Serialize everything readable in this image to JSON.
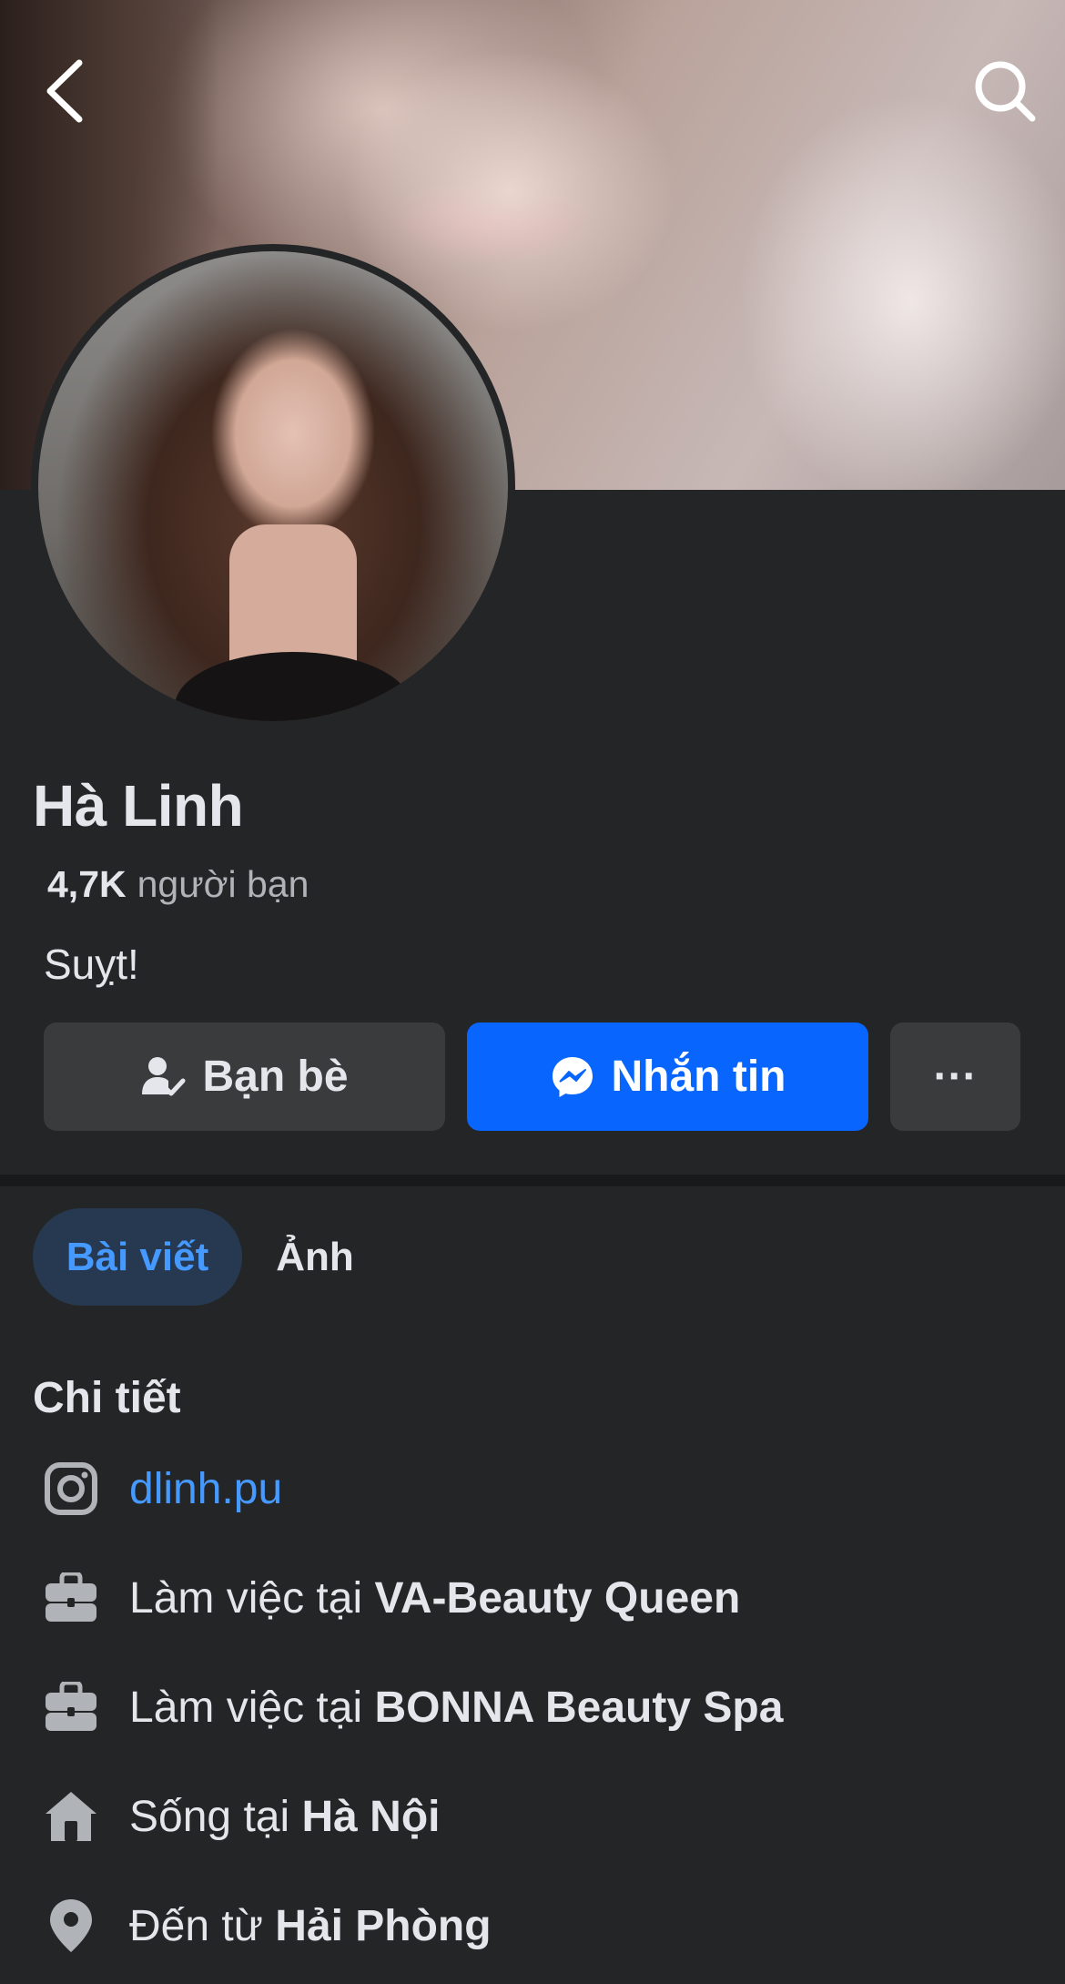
{
  "header": {
    "back_icon": "chevron-left-icon",
    "search_icon": "search-icon"
  },
  "profile": {
    "name": "Hà Linh",
    "friends_count": "4,7K",
    "friends_label": "người bạn",
    "bio": "Suỵt!"
  },
  "actions": {
    "friends_label": "Bạn bè",
    "friends_icon": "friend-check-icon",
    "message_label": "Nhắn tin",
    "message_icon": "messenger-icon",
    "more_label": "···",
    "accent": "#0866ff"
  },
  "tabs": [
    {
      "label": "Bài viết",
      "active": true
    },
    {
      "label": "Ảnh",
      "active": false
    }
  ],
  "details": {
    "title": "Chi tiết",
    "items": [
      {
        "icon": "instagram-icon",
        "prefix": "",
        "value": "dlinh.pu",
        "link": true
      },
      {
        "icon": "briefcase-icon",
        "prefix": "Làm việc tại ",
        "value": "VA-Beauty Queen",
        "link": false
      },
      {
        "icon": "briefcase-icon",
        "prefix": "Làm việc tại ",
        "value": "BONNA Beauty Spa",
        "link": false
      },
      {
        "icon": "home-icon",
        "prefix": "Sống tại ",
        "value": "Hà Nội",
        "link": false
      },
      {
        "icon": "location-pin-icon",
        "prefix": "Đến từ ",
        "value": "Hải Phòng",
        "link": false
      }
    ]
  }
}
